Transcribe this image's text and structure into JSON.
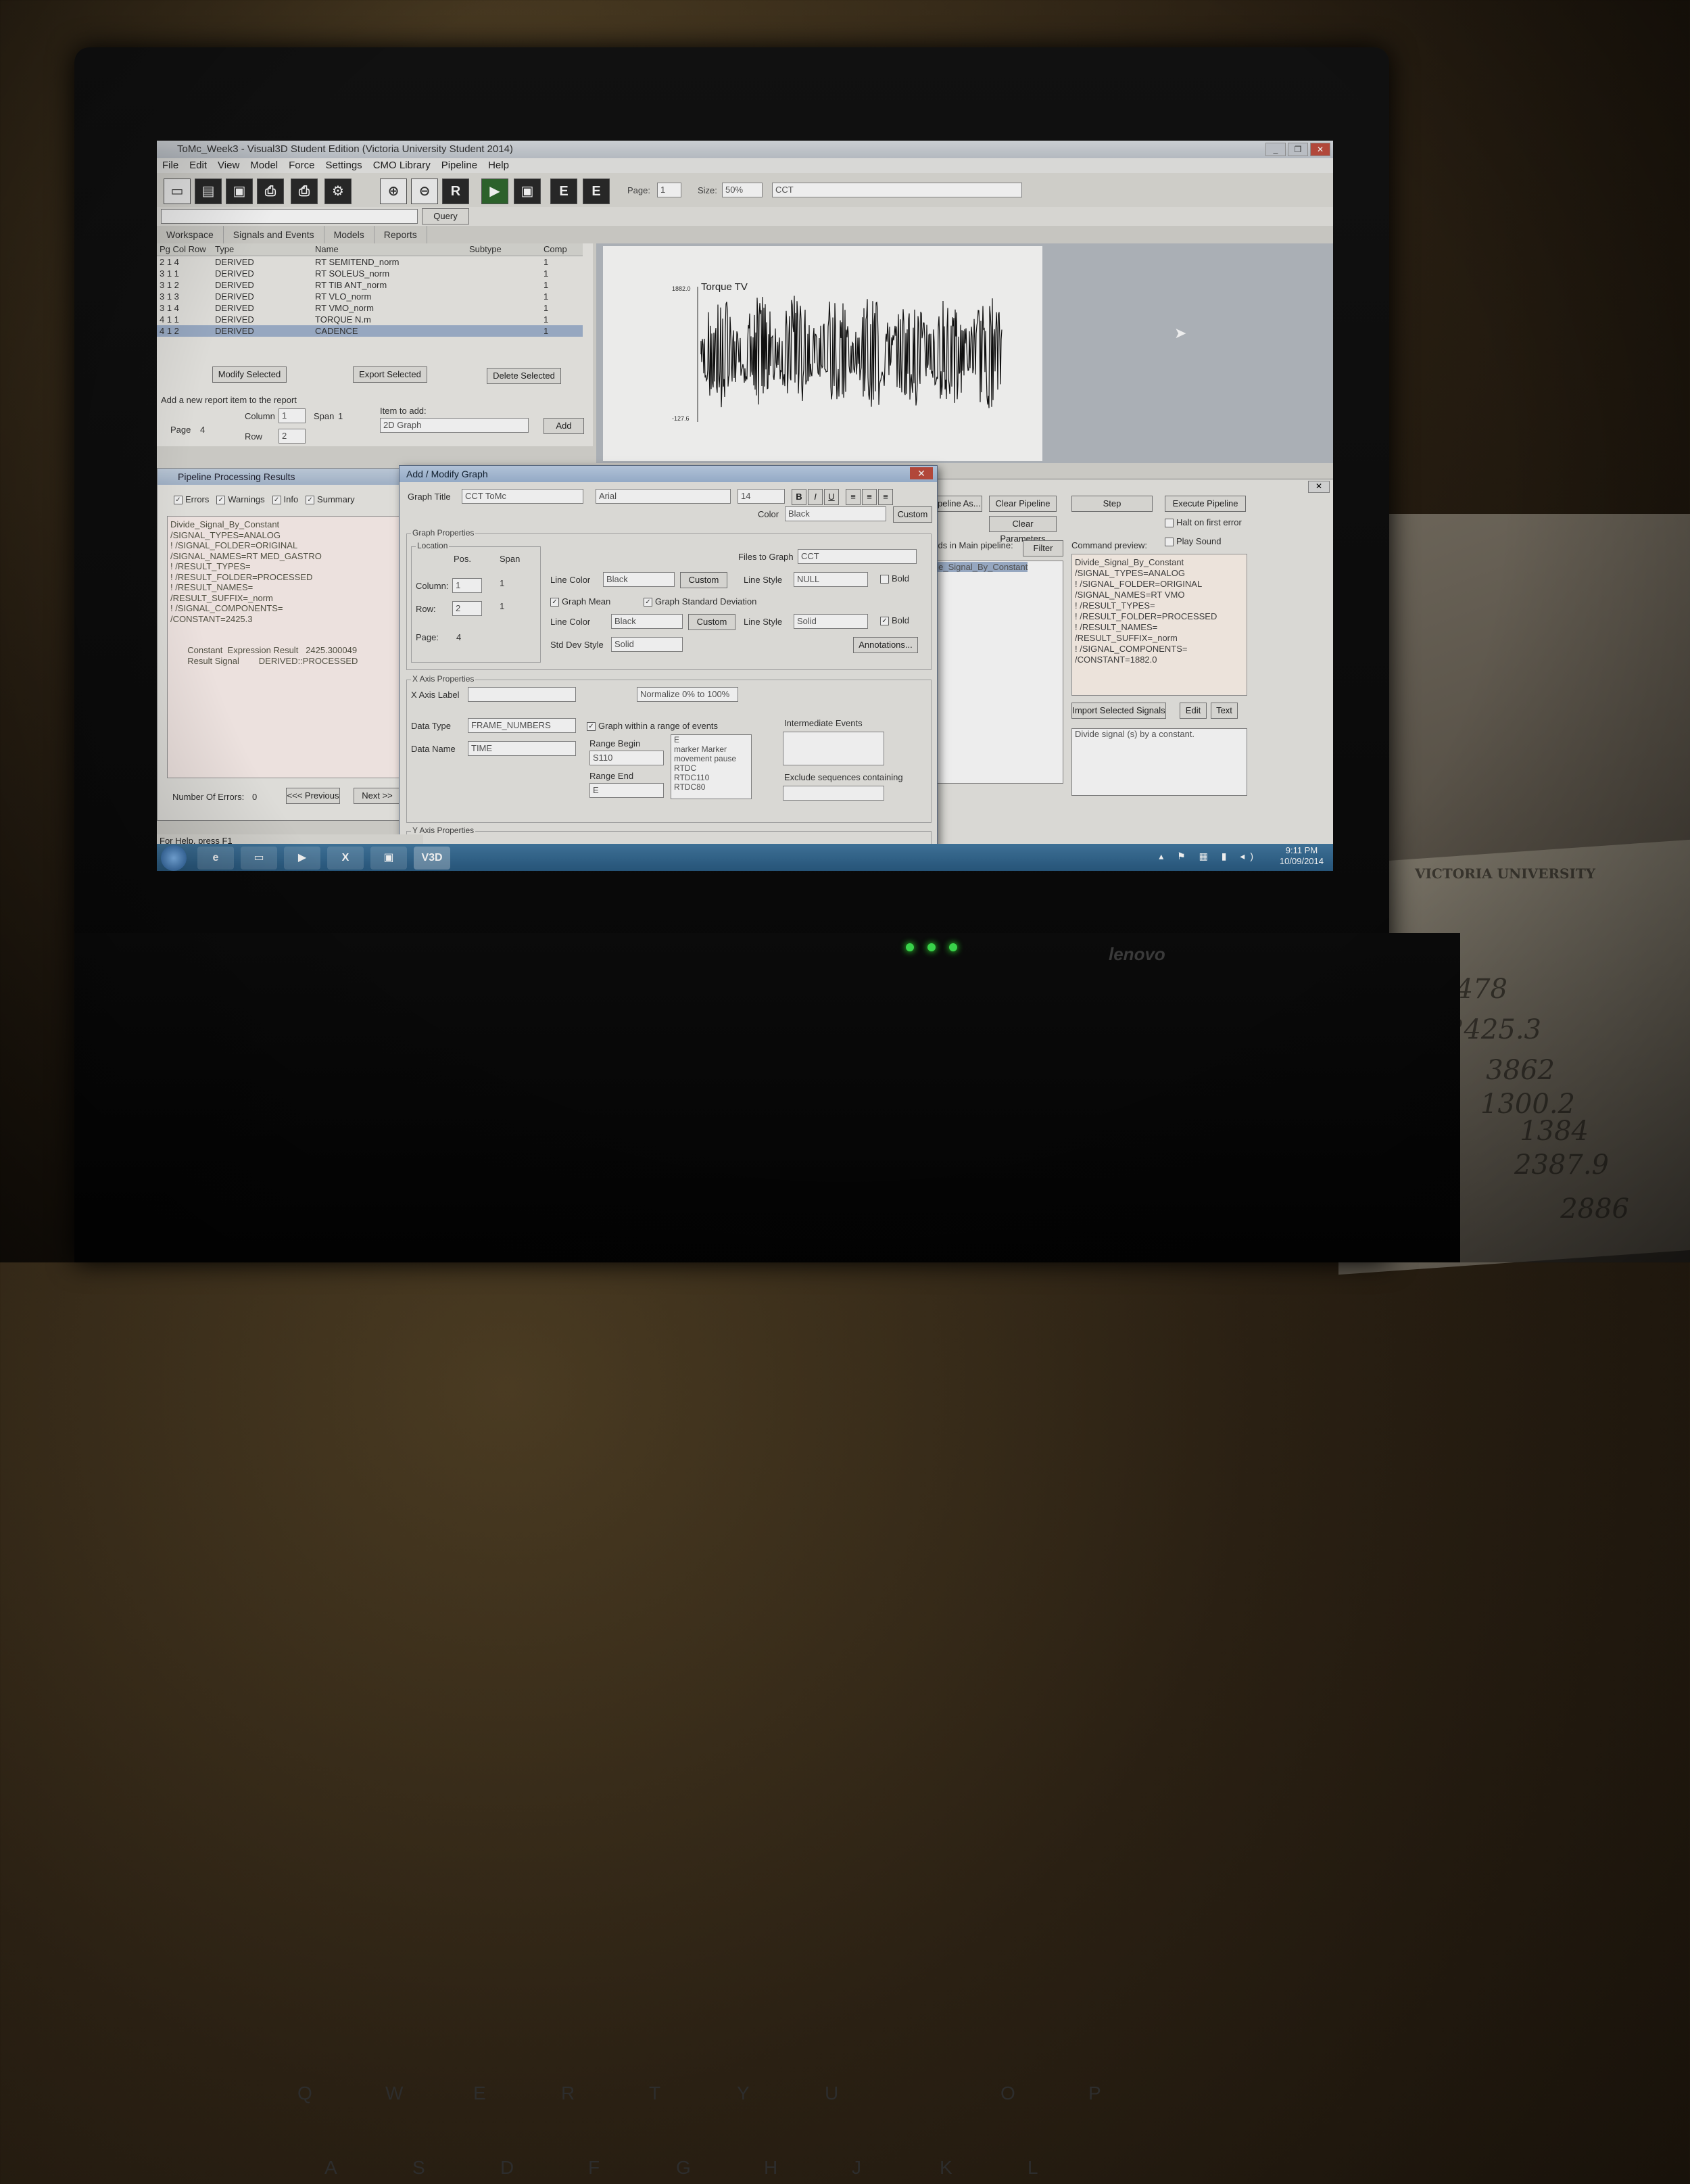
{
  "window": {
    "title": "ToMc_Week3 - Visual3D Student Edition (Victoria University Student 2014)"
  },
  "menu": [
    "File",
    "Edit",
    "View",
    "Model",
    "Force",
    "Settings",
    "CMO Library",
    "Pipeline",
    "Help"
  ],
  "toolbar": {
    "page_label": "Page:",
    "page_value": "1",
    "size_label": "Size:",
    "size_value": "50%",
    "file_value": "CCT",
    "query_label": "Query"
  },
  "tabs": [
    "Workspace",
    "Signals and Events",
    "Models",
    "Reports"
  ],
  "report_table": {
    "headers": [
      "Pg Col Row",
      "Type",
      "Name",
      "Subtype",
      "Comp"
    ],
    "rows": [
      [
        "2  1  4",
        "DERIVED",
        "RT SEMITEND_norm",
        "",
        "1"
      ],
      [
        "3  1  1",
        "DERIVED",
        "RT SOLEUS_norm",
        "",
        "1"
      ],
      [
        "3  1  2",
        "DERIVED",
        "RT TIB ANT_norm",
        "",
        "1"
      ],
      [
        "3  1  3",
        "DERIVED",
        "RT VLO_norm",
        "",
        "1"
      ],
      [
        "3  1  4",
        "DERIVED",
        "RT VMO_norm",
        "",
        "1"
      ],
      [
        "4  1  1",
        "DERIVED",
        "TORQUE N.m",
        "",
        "1"
      ],
      [
        "4  1  2",
        "DERIVED",
        "CADENCE",
        "",
        "1"
      ]
    ]
  },
  "report_actions": {
    "modify": "Modify Selected",
    "export": "Export Selected",
    "delete": "Delete Selected",
    "add_header": "Add a new report item to the report",
    "page_label": "Page",
    "page_val": "4",
    "column_label": "Column",
    "column_val": "1",
    "row_label": "Row",
    "row_val": "2",
    "span_label": "Span",
    "span_val": "1",
    "item_label": "Item to add:",
    "item_val": "2D Graph",
    "add": "Add"
  },
  "graph": {
    "title": "Torque TV",
    "ymax": "1882.0",
    "ymin": "-127.6"
  },
  "pipeline_results": {
    "title": "Pipeline Processing Results",
    "filters": [
      "Errors",
      "Warnings",
      "Info",
      "Summary"
    ],
    "log": "Divide_Signal_By_Constant\n/SIGNAL_TYPES=ANALOG\n! /SIGNAL_FOLDER=ORIGINAL\n/SIGNAL_NAMES=RT MED_GASTRO\n! /RESULT_TYPES=\n! /RESULT_FOLDER=PROCESSED\n! /RESULT_NAMES=\n/RESULT_SUFFIX=_norm\n! /SIGNAL_COMPONENTS=\n/CONSTANT=2425.3\n\n\n       Constant  Expression Result   2425.300049\n       Result Signal        DERIVED::PROCESSED",
    "errors_label": "Number Of Errors:",
    "errors": "0",
    "prev": "<<< Previous",
    "next": "Next >>"
  },
  "dialog": {
    "title": "Add / Modify Graph",
    "graph_title_label": "Graph Title",
    "graph_title": "CCT ToMc",
    "font": "Arial",
    "size": "14",
    "color_label": "Color",
    "color": "Black",
    "custom": "Custom",
    "props_label": "Graph Properties",
    "location_label": "Location",
    "pos_label": "Pos.",
    "span_label": "Span",
    "column_label": "Column:",
    "column_val": "1",
    "row_label": "Row:",
    "row_val": "2",
    "page_label": "Page:",
    "page_val": "4",
    "span1": "1",
    "span2": "1",
    "files_label": "Files to Graph",
    "files_val": "CCT",
    "line_color_label": "Line Color",
    "line_color": "Black",
    "line_style_label": "Line Style",
    "line_style": "NULL",
    "bold": "Bold",
    "mean_label": "Graph Mean",
    "sd_label": "Graph Standard Deviation",
    "line_color2": "Black",
    "line_style2": "Solid",
    "sd_style_label": "Std Dev Style",
    "sd_style": "Solid",
    "annotations": "Annotations...",
    "xaxis_label": "X Axis Properties",
    "xaxis_name_label": "X Axis Label",
    "normalize": "Normalize 0% to 100%",
    "data_type_label": "Data Type",
    "data_type": "FRAME_NUMBERS",
    "data_name_label": "Data Name",
    "data_name": "TIME",
    "range_events": "Graph within a range of events",
    "range_begin_label": "Range Begin",
    "range_begin": "S110",
    "range_end_label": "Range End",
    "range_end": "E",
    "events_list": [
      "E",
      "marker Marker",
      "movement pause",
      "RTDC",
      "RTDC110",
      "RTDC80",
      "RTDC95"
    ],
    "intermediate": "Intermediate Events",
    "exclude": "Exclude sequences containing",
    "yaxis_label": "Y Axis Properties"
  },
  "pipeline_panel": {
    "save_as": "Pipeline As...",
    "clear_pipeline": "Clear Pipeline",
    "clear_params": "Clear Parameters",
    "step": "Step",
    "execute": "Execute Pipeline",
    "halt": "Halt on first error",
    "play_sound": "Play Sound",
    "commands_label": "ands in Main pipeline:",
    "filter": "Filter",
    "command_item": "ide_Signal_By_Constant",
    "preview_label": "Command preview:",
    "preview": "Divide_Signal_By_Constant\n/SIGNAL_TYPES=ANALOG\n! /SIGNAL_FOLDER=ORIGINAL\n/SIGNAL_NAMES=RT VMO\n! /RESULT_TYPES=\n! /RESULT_FOLDER=PROCESSED\n! /RESULT_NAMES=\n/RESULT_SUFFIX=_norm\n! /SIGNAL_COMPONENTS=\n/CONSTANT=1882.0",
    "import": "Import Selected Signals",
    "edit": "Edit",
    "text": "Text",
    "desc": "Divide signal (s) by a constant."
  },
  "status_bar": "For Help, press F1",
  "taskbar": {
    "time": "9:11 PM",
    "date": "10/09/2014",
    "apps": [
      "ie-icon",
      "explorer-icon",
      "media-icon",
      "excel-icon",
      "app-icon",
      "visual3d-icon"
    ]
  },
  "laptop": {
    "brand": "lenovo",
    "leds": [
      "power",
      "battery",
      "disk"
    ]
  },
  "paper_notes": [
    "VICTORIA UNIVERSITY",
    "1478",
    "2425.3",
    "3862",
    "1300.2",
    "1384",
    "2387.9",
    "2886"
  ]
}
